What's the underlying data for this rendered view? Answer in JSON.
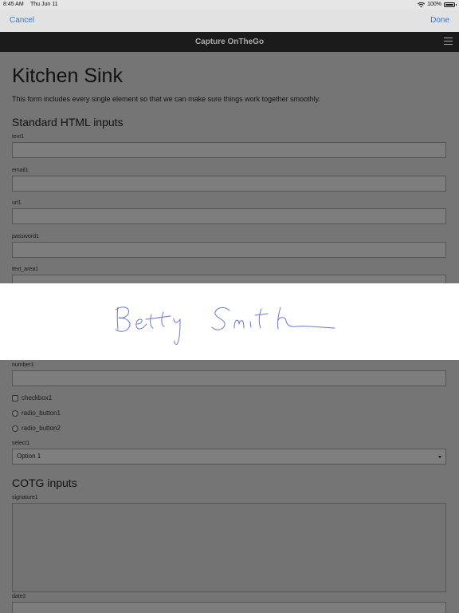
{
  "status_bar": {
    "time": "8:45 AM",
    "date": "Thu Jun 11",
    "battery": "100%"
  },
  "modal_nav": {
    "cancel_label": "Cancel",
    "done_label": "Done"
  },
  "app_header": {
    "title": "Capture OnTheGo"
  },
  "form": {
    "title": "Kitchen Sink",
    "intro": "This form includes every single element so that we can make sure things work together smoothly.",
    "standard_section_title": "Standard HTML inputs",
    "fields": [
      {
        "label": "text1"
      },
      {
        "label": "email1"
      },
      {
        "label": "url1"
      },
      {
        "label": "password1"
      },
      {
        "label": "text_area1"
      },
      {
        "label": "number1"
      }
    ],
    "checkbox_label": "checkbox1",
    "radio1_label": "radio_button1",
    "radio2_label": "radio_button2",
    "select_label": "select1",
    "select_value": "Option 1",
    "cotg_section_title": "COTG inputs",
    "signature_label": "signature1",
    "date_label": "date2"
  },
  "colors": {
    "link_blue": "#2b7bd6",
    "header_bg": "#1f1f1f",
    "signature_ink": "#6a78c8"
  }
}
